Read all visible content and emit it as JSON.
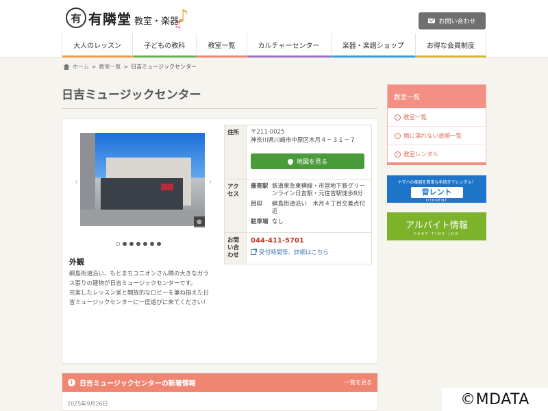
{
  "header": {
    "logo_name": "有隣堂",
    "logo_sub": "教室・楽器",
    "contact_label": "お問い合わせ"
  },
  "nav": {
    "items": [
      {
        "label": "大人のレッスン",
        "color": "#f39a4a"
      },
      {
        "label": "子どもの教科",
        "color": "#63b34e"
      },
      {
        "label": "教室一覧",
        "color": "#f08572"
      },
      {
        "label": "カルチャーセンター",
        "color": "#9b72c6"
      },
      {
        "label": "楽器・楽譜ショップ",
        "color": "#3a9bd8"
      },
      {
        "label": "お得な会員制度",
        "color": "#d9b23a"
      }
    ]
  },
  "breadcrumb": {
    "home": "ホーム",
    "sep1": ">",
    "parent": "教室一覧",
    "sep2": ">",
    "current": "日吉ミュージックセンター"
  },
  "page": {
    "title": "日吉ミュージックセンター"
  },
  "gallery": {
    "dots": [
      true,
      false,
      false,
      false,
      false,
      false,
      false
    ],
    "caption": "外観",
    "description": "綱島街道沿い、もとまちユニオンさん隣の大きなガラス張りの建物が日吉ミュージックセンターです。\n充実したレッスン室と開放的なロビーを兼ね揃えた日吉ミュージックセンターに一度遊びに来てください！"
  },
  "info": {
    "address_label": "住所",
    "postal": "〒211-0025",
    "address": "神奈川県川崎市中原区木月４－３１－７",
    "map_button": "地図を見る",
    "access_label": "アクセス",
    "access": [
      {
        "key": "最寄駅",
        "value": "鉄道東急東横線・市営地下鉄グリーンライン日吉駅・元住吉駅徒歩8分"
      },
      {
        "key": "目印",
        "value": "綱島街道沿い　木月４丁目交差点付近"
      },
      {
        "key": "駐車場",
        "value": "なし"
      }
    ],
    "contact_label": "お問い合わせ",
    "phone": "044-411-5701",
    "hours_link": "受付時間等、詳細はこちら"
  },
  "news": {
    "title": "日吉ミュージックセンターの新着情報",
    "more": "一覧を見る",
    "date": "2025年9月26日"
  },
  "sidebar": {
    "heading": "教室一覧",
    "items": [
      {
        "label": "教室一覧"
      },
      {
        "label": "雨に濡れない道順一覧"
      },
      {
        "label": "教室レンタル"
      }
    ]
  },
  "banners": {
    "rental_small": "ヤマハの楽器を簡単な手続きでレンタル！",
    "rental_big": "音レント",
    "rental_tiny": "OTORENT",
    "job_big": "アルバイト情報",
    "job_tiny": "PART TIME JOB"
  },
  "copyright": "©MDATA"
}
